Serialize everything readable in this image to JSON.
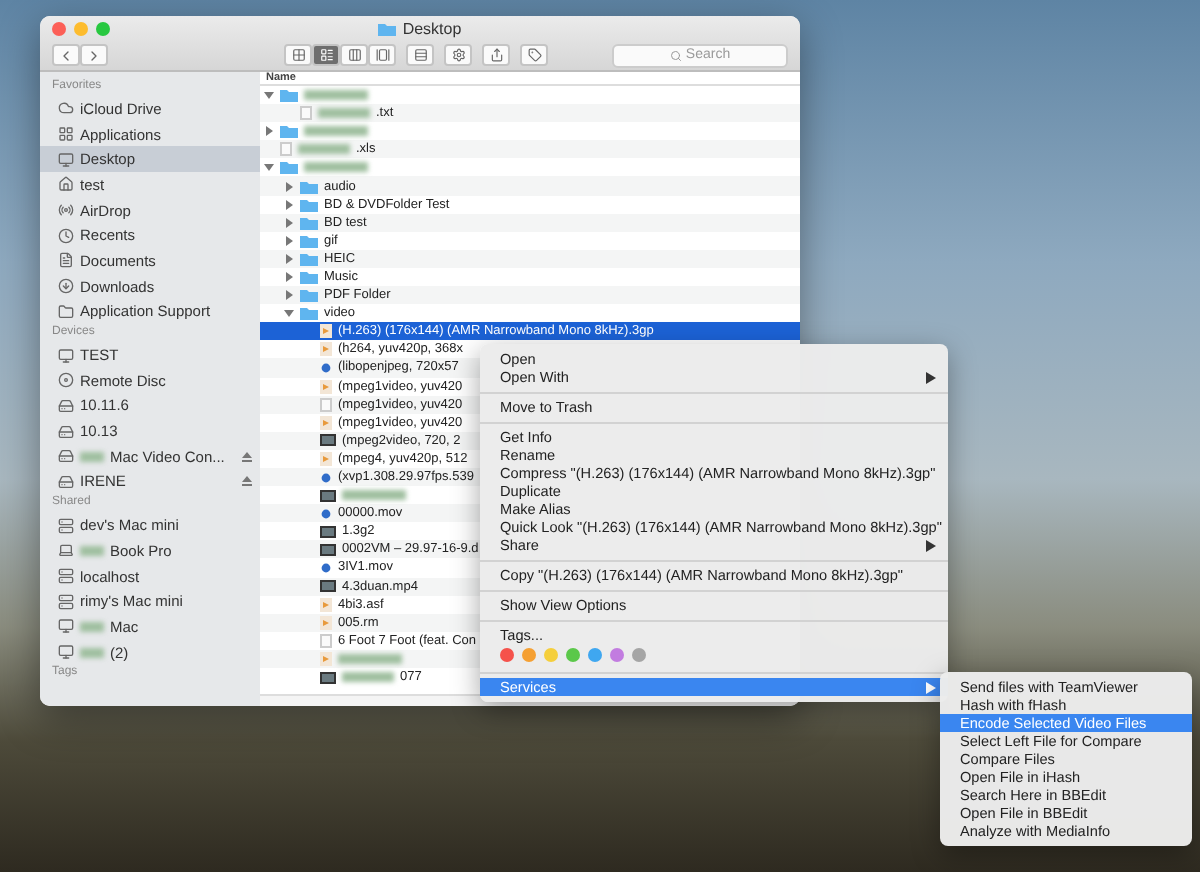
{
  "window": {
    "title": "Desktop"
  },
  "toolbar": {
    "views": [
      {
        "kind": "icons",
        "selected": false
      },
      {
        "kind": "list",
        "selected": true
      },
      {
        "kind": "columns",
        "selected": false
      },
      {
        "kind": "gallery",
        "selected": false
      }
    ],
    "search": {
      "placeholder": "Search"
    }
  },
  "sidebar": [
    {
      "title": "Favorites",
      "items": [
        {
          "label": "iCloud Drive",
          "kind": "cloud",
          "selected": false,
          "eject": false
        },
        {
          "label": "Applications",
          "kind": "apps",
          "selected": false,
          "eject": false
        },
        {
          "label": "Desktop",
          "kind": "desktop",
          "selected": true,
          "eject": false
        },
        {
          "label": "test",
          "kind": "home",
          "selected": false,
          "eject": false
        },
        {
          "label": "AirDrop",
          "kind": "airdrop",
          "selected": false,
          "eject": false
        },
        {
          "label": "Recents",
          "kind": "recents",
          "selected": false,
          "eject": false
        },
        {
          "label": "Documents",
          "kind": "documents",
          "selected": false,
          "eject": false
        },
        {
          "label": "Downloads",
          "kind": "downloads",
          "selected": false,
          "eject": false
        },
        {
          "label": "Application Support",
          "kind": "folder",
          "selected": false,
          "eject": false
        }
      ]
    },
    {
      "title": "Devices",
      "items": [
        {
          "label": "TEST",
          "kind": "display",
          "selected": false,
          "eject": false
        },
        {
          "label": "Remote Disc",
          "kind": "disc",
          "selected": false,
          "eject": false
        },
        {
          "label": "10.11.6",
          "kind": "drive",
          "selected": false,
          "eject": false
        },
        {
          "label": "10.13",
          "kind": "drive",
          "selected": false,
          "eject": false
        },
        {
          "label": "Mac Video Con...",
          "redacted": true,
          "kind": "drive",
          "selected": false,
          "eject": true
        },
        {
          "label": "IRENE",
          "kind": "drive",
          "selected": false,
          "eject": true
        }
      ]
    },
    {
      "title": "Shared",
      "items": [
        {
          "label": "dev's Mac mini",
          "kind": "server",
          "selected": false,
          "eject": false
        },
        {
          "label": "Book Pro",
          "redacted": true,
          "kind": "laptop",
          "selected": false,
          "eject": false
        },
        {
          "label": "localhost",
          "kind": "server",
          "selected": false,
          "eject": false
        },
        {
          "label": "rimy's Mac mini",
          "kind": "server",
          "selected": false,
          "eject": false
        },
        {
          "label": "Mac",
          "redacted": true,
          "kind": "display",
          "selected": false,
          "eject": false
        },
        {
          "label": "(2)",
          "redacted": true,
          "kind": "display",
          "selected": false,
          "eject": false
        }
      ]
    },
    {
      "title": "Tags"
    }
  ],
  "list": {
    "column": "Name",
    "rows": [
      {
        "redacted": true,
        "kind": "folder",
        "expanded": true,
        "children": [
          {
            "name": ".txt",
            "redacted": true,
            "kind": "blank"
          }
        ]
      },
      {
        "redacted": true,
        "kind": "folder",
        "expanded": false
      },
      {
        "name": ".xls",
        "redacted": true,
        "kind": "blank"
      },
      {
        "redacted": true,
        "kind": "folder",
        "expanded": true,
        "children": [
          {
            "name": "audio",
            "kind": "folder",
            "expanded": false
          },
          {
            "name": "BD & DVDFolder Test",
            "kind": "folder",
            "expanded": false
          },
          {
            "name": "BD test",
            "kind": "folder",
            "expanded": false
          },
          {
            "name": "gif",
            "kind": "folder",
            "expanded": false
          },
          {
            "name": "HEIC",
            "kind": "folder",
            "expanded": false
          },
          {
            "name": "Music",
            "kind": "folder",
            "expanded": false
          },
          {
            "name": "PDF Folder",
            "kind": "folder",
            "expanded": false
          },
          {
            "name": "video",
            "kind": "folder",
            "expanded": true,
            "children": [
              {
                "name": "(H.263) (176x144) (AMR Narrowband Mono 8kHz).3gp",
                "kind": "clip",
                "selected": true
              },
              {
                "name": "(h264, yuv420p, 368x",
                "kind": "clip",
                "selected": false
              },
              {
                "name": "(libopenjpeg, 720x57",
                "kind": "movie",
                "selected": false
              },
              {
                "name": "(mpeg1video, yuv420",
                "kind": "clip",
                "selected": false
              },
              {
                "name": "(mpeg1video, yuv420",
                "kind": "blank",
                "selected": false
              },
              {
                "name": "(mpeg1video, yuv420",
                "kind": "clip",
                "selected": false
              },
              {
                "name": "(mpeg2video, 720, 2",
                "kind": "image",
                "selected": false
              },
              {
                "name": "(mpeg4, yuv420p, 512",
                "kind": "clip",
                "selected": false
              },
              {
                "name": "(xvp1.308.29.97fps.539",
                "kind": "movie",
                "selected": false
              },
              {
                "redacted": true,
                "kind": "image",
                "selected": false
              },
              {
                "name": "00000.mov",
                "kind": "movie",
                "selected": false
              },
              {
                "name": "1.3g2",
                "kind": "image",
                "selected": false
              },
              {
                "name": "0002VM – 29.97-16-9.d",
                "kind": "image",
                "selected": false
              },
              {
                "name": "3IV1.mov",
                "kind": "movie",
                "selected": false
              },
              {
                "name": "4.3duan.mp4",
                "kind": "image",
                "selected": false
              },
              {
                "name": "4bi3.asf",
                "kind": "clip",
                "selected": false
              },
              {
                "name": "005.rm",
                "kind": "clip",
                "selected": false
              },
              {
                "name": "6 Foot 7 Foot (feat. Con",
                "kind": "blank",
                "selected": false
              },
              {
                "redacted": true,
                "kind": "clip",
                "selected": false
              },
              {
                "name": "077",
                "redacted": true,
                "kind": "image",
                "selected": false
              }
            ]
          }
        ]
      }
    ]
  },
  "context_menu": {
    "items": [
      {
        "kind": "item",
        "label": "Open",
        "selected": false
      },
      {
        "kind": "item",
        "label": "Open With",
        "submenu": true,
        "selected": false
      },
      {
        "kind": "separator"
      },
      {
        "kind": "item",
        "label": "Move to Trash",
        "selected": false
      },
      {
        "kind": "separator"
      },
      {
        "kind": "item",
        "label": "Get Info",
        "selected": false
      },
      {
        "kind": "item",
        "label": "Rename",
        "selected": false
      },
      {
        "kind": "item",
        "label": "Compress \"(H.263) (176x144) (AMR Narrowband Mono 8kHz).3gp\"",
        "selected": false
      },
      {
        "kind": "item",
        "label": "Duplicate",
        "selected": false
      },
      {
        "kind": "item",
        "label": "Make Alias",
        "selected": false
      },
      {
        "kind": "item",
        "label": "Quick Look \"(H.263) (176x144) (AMR Narrowband Mono 8kHz).3gp\"",
        "selected": false
      },
      {
        "kind": "item",
        "label": "Share",
        "submenu": true,
        "selected": false
      },
      {
        "kind": "separator"
      },
      {
        "kind": "item",
        "label": "Copy \"(H.263) (176x144) (AMR Narrowband Mono 8kHz).3gp\"",
        "selected": false
      },
      {
        "kind": "separator"
      },
      {
        "kind": "item",
        "label": "Show View Options",
        "selected": false
      },
      {
        "kind": "separator"
      },
      {
        "kind": "item",
        "label": "Tags...",
        "selected": false
      },
      {
        "kind": "tags",
        "tags": [
          {
            "color": "#f5524b"
          },
          {
            "color": "#f5a033"
          },
          {
            "color": "#f5cf3c"
          },
          {
            "color": "#5bc84a"
          },
          {
            "color": "#3fa7f0"
          },
          {
            "color": "#c27ce0"
          },
          {
            "color": "#a5a5a5"
          }
        ]
      },
      {
        "kind": "separator"
      },
      {
        "kind": "item",
        "label": "Services",
        "submenu": true,
        "selected": true
      }
    ]
  },
  "services_menu": {
    "items": [
      {
        "label": "Send files with TeamViewer",
        "selected": false
      },
      {
        "label": "Hash with fHash",
        "selected": false
      },
      {
        "label": "Encode Selected Video Files",
        "selected": true
      },
      {
        "label": "Select Left File for Compare",
        "selected": false
      },
      {
        "label": "Compare Files",
        "selected": false
      },
      {
        "label": "Open File in iHash",
        "selected": false
      },
      {
        "label": "Search Here in BBEdit",
        "selected": false
      },
      {
        "label": "Open File in BBEdit",
        "selected": false
      },
      {
        "label": "Analyze with MediaInfo",
        "selected": false
      }
    ]
  }
}
